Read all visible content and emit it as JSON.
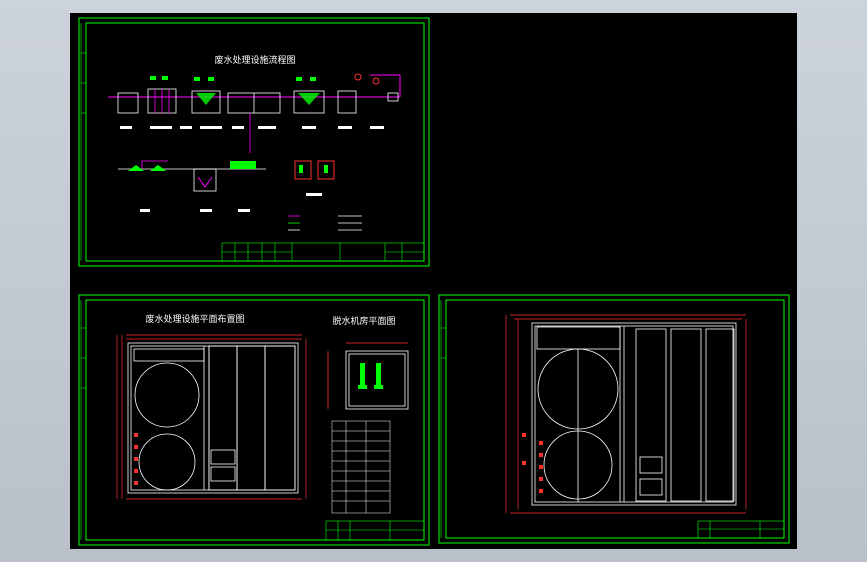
{
  "sheets": [
    {
      "title": "废水处理设施流程图"
    },
    {
      "title": "废水处理设施平面布置图",
      "subtitle": "脱水机房平面图"
    },
    {
      "title": ""
    }
  ],
  "colors": {
    "frame": "#00ff00",
    "wall": "#ffffff",
    "pipe": "#ff00ff",
    "dimension": "#ff3030",
    "background": "#000000",
    "workspace": "#c4cad1"
  }
}
